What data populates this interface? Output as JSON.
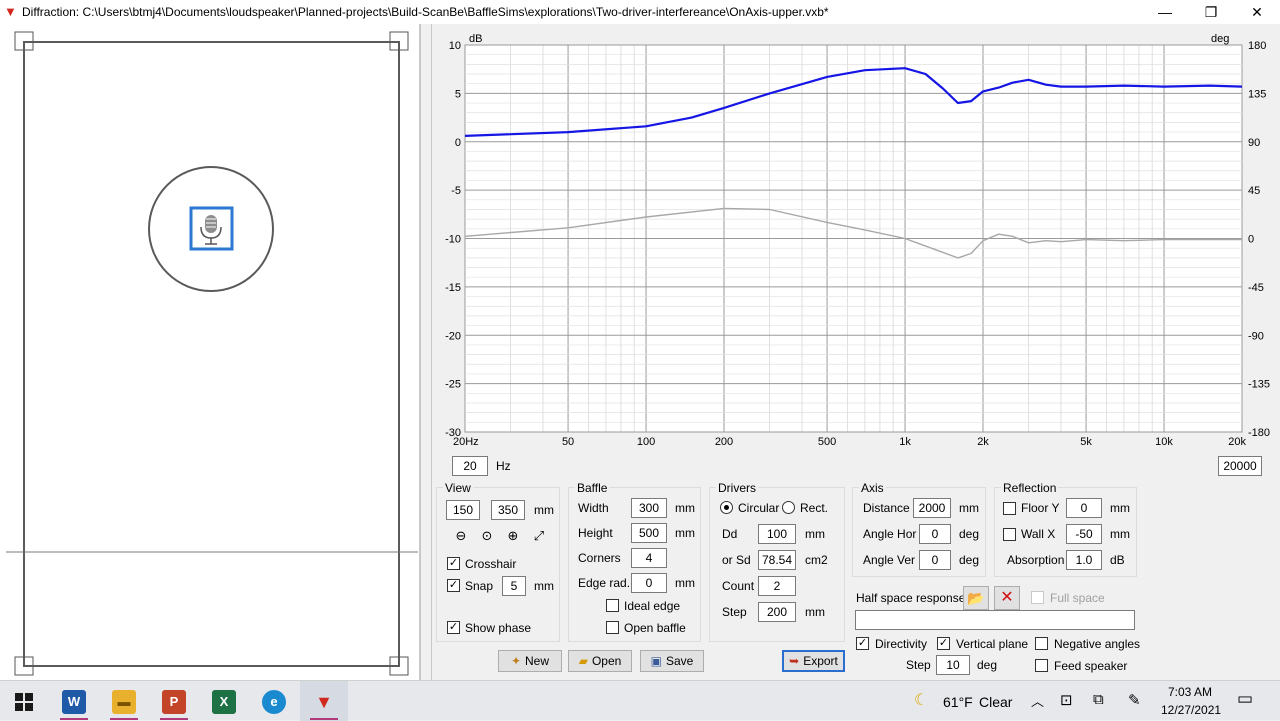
{
  "window": {
    "title": "Diffraction: C:\\Users\\btmj4\\Documents\\loudspeaker\\Planned-projects\\Build-ScanBe\\BaffleSims\\explorations\\Two-driver-interfereance\\OnAxis-upper.vxb*",
    "minimize": "—",
    "maximize": "❐",
    "close": "✕"
  },
  "chart": {
    "left_unit": "dB",
    "right_unit": "deg",
    "y_ticks": [
      "10",
      "5",
      "0",
      "-5",
      "-10",
      "-15",
      "-20",
      "-25",
      "-30"
    ],
    "phase_ticks": [
      "180",
      "135",
      "90",
      "45",
      "0",
      "-45",
      "-90",
      "-135",
      "-180"
    ],
    "x_ticks": [
      "20Hz",
      "50",
      "100",
      "200",
      "500",
      "1k",
      "2k",
      "5k",
      "10k",
      "20k"
    ],
    "freq_min": "20",
    "freq_unit": "Hz",
    "freq_max": "20000"
  },
  "chart_data": {
    "type": "line",
    "xscale": "log",
    "xlim": [
      20,
      20000
    ],
    "ylim": [
      -30,
      10
    ],
    "y2lim": [
      -180,
      180
    ],
    "xlabel": "",
    "ylabel": "dB",
    "y2label": "deg",
    "grid": true,
    "series": [
      {
        "color": "#1515e6",
        "axis": "left",
        "x": [
          20,
          50,
          100,
          150,
          200,
          300,
          500,
          700,
          1000,
          1200,
          1400,
          1600,
          1800,
          2000,
          2300,
          2600,
          3000,
          3500,
          4000,
          5000,
          7000,
          10000,
          15000,
          20000
        ],
        "y": [
          0.6,
          1.0,
          1.6,
          2.5,
          3.5,
          5.0,
          6.7,
          7.4,
          7.6,
          7.0,
          5.5,
          4.0,
          4.2,
          5.2,
          5.6,
          6.1,
          6.4,
          5.9,
          5.7,
          5.7,
          5.8,
          5.7,
          5.8,
          5.7
        ]
      },
      {
        "color": "#a8a8a8",
        "axis": "right",
        "x": [
          20,
          50,
          100,
          200,
          300,
          500,
          700,
          1000,
          1300,
          1600,
          1800,
          2000,
          2300,
          2600,
          3000,
          3500,
          4000,
          5000,
          7000,
          10000,
          20000
        ],
        "y": [
          2,
          10,
          20,
          28,
          27,
          15,
          8,
          0,
          -10,
          -18,
          -14,
          -2,
          4,
          2,
          -4,
          -2,
          -3,
          -1,
          -2,
          -1,
          -1
        ]
      }
    ]
  },
  "view": {
    "title": "View",
    "w": "150",
    "h": "350",
    "unit": "mm",
    "crosshair": "Crosshair",
    "snap": "Snap",
    "snap_val": "5",
    "snap_unit": "mm",
    "show_phase": "Show phase"
  },
  "baffle": {
    "title": "Baffle",
    "width_label": "Width",
    "width": "300",
    "height_label": "Height",
    "height": "500",
    "corners_label": "Corners",
    "corners": "4",
    "edge_label": "Edge rad.",
    "edge": "0",
    "unit": "mm",
    "ideal_edge": "Ideal edge",
    "open_baffle": "Open baffle"
  },
  "drivers": {
    "title": "Drivers",
    "circular": "Circular",
    "rect": "Rect.",
    "dd_label": "Dd",
    "dd": "100",
    "dd_unit": "mm",
    "sd_label": "or Sd",
    "sd": "78.54",
    "sd_unit": "cm2",
    "count_label": "Count",
    "count": "2",
    "step_label": "Step",
    "step": "200",
    "step_unit": "mm"
  },
  "axis": {
    "title": "Axis",
    "distance_label": "Distance",
    "distance": "2000",
    "distance_unit": "mm",
    "hor_label": "Angle Hor",
    "hor": "0",
    "ver_label": "Angle Ver",
    "ver": "0",
    "deg": "deg"
  },
  "reflection": {
    "title": "Reflection",
    "floor_label": "Floor Y",
    "floor": "0",
    "wall_label": "Wall  X",
    "wall": "-50",
    "unit": "mm",
    "absorption_label": "Absorption",
    "absorption": "1.0",
    "absorption_unit": "dB"
  },
  "halfspace": {
    "label": "Half space response",
    "full_space": "Full space",
    "directivity": "Directivity",
    "vertical_plane": "Vertical plane",
    "negative_angles": "Negative angles",
    "step_label": "Step",
    "step": "10",
    "step_unit": "deg",
    "feed_speaker": "Feed speaker"
  },
  "buttons": {
    "new": "New",
    "open": "Open",
    "save": "Save",
    "export": "Export"
  },
  "taskbar": {
    "weather_temp": "61°F",
    "weather_text": "Clear",
    "time": "7:03 AM",
    "date": "12/27/2021"
  }
}
